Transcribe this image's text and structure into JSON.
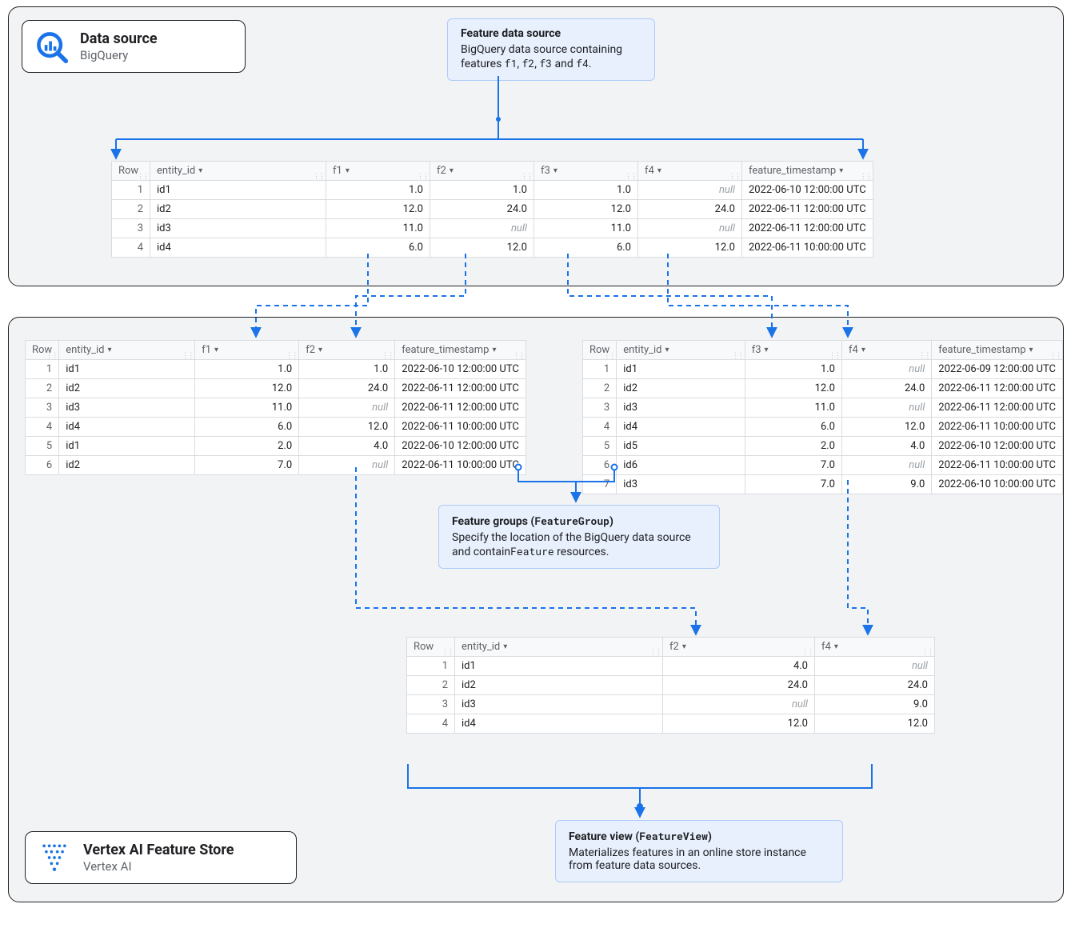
{
  "top": {
    "tag_title": "Data source",
    "tag_sub": "BigQuery",
    "callout": {
      "head": "Feature data source",
      "body_a": "BigQuery data source containing features ",
      "f1": "f1",
      "f2": "f2",
      "f3": "f3",
      "f4": "f4",
      "body_b": ", ",
      "body_c": " and ",
      "body_d": "."
    },
    "source_table": {
      "headers": [
        "Row",
        "entity_id",
        "f1",
        "f2",
        "f3",
        "f4",
        "feature_timestamp"
      ],
      "rows": [
        {
          "n": "1",
          "id": "id1",
          "f1": "1.0",
          "f2": "1.0",
          "f3": "1.0",
          "f4": "null",
          "ts": "2022-06-10 12:00:00 UTC"
        },
        {
          "n": "2",
          "id": "id2",
          "f1": "12.0",
          "f2": "24.0",
          "f3": "12.0",
          "f4": "24.0",
          "ts": "2022-06-11 12:00:00 UTC"
        },
        {
          "n": "3",
          "id": "id3",
          "f1": "11.0",
          "f2": "null",
          "f3": "11.0",
          "f4": "null",
          "ts": "2022-06-11 12:00:00 UTC"
        },
        {
          "n": "4",
          "id": "id4",
          "f1": "6.0",
          "f2": "12.0",
          "f3": "6.0",
          "f4": "12.0",
          "ts": "2022-06-11 10:00:00 UTC"
        }
      ]
    }
  },
  "bottom": {
    "tag_title": "Vertex AI Feature Store",
    "tag_sub": "Vertex AI",
    "group_callout": {
      "head_a": "Feature groups (",
      "head_b": "FeatureGroup",
      "head_c": ")",
      "line_a": "Specify the location of the BigQuery data source and contain",
      "line_b": "Feature",
      "line_c": " resources."
    },
    "view_callout": {
      "head_a": "Feature view (",
      "head_b": "FeatureView",
      "head_c": ")",
      "line": "Materializes features in an online store instance from feature data sources."
    },
    "left_table": {
      "headers": [
        "Row",
        "entity_id",
        "f1",
        "f2",
        "feature_timestamp"
      ],
      "rows": [
        {
          "n": "1",
          "id": "id1",
          "v1": "1.0",
          "v2": "1.0",
          "ts": "2022-06-10 12:00:00 UTC"
        },
        {
          "n": "2",
          "id": "id2",
          "v1": "12.0",
          "v2": "24.0",
          "ts": "2022-06-11 12:00:00 UTC"
        },
        {
          "n": "3",
          "id": "id3",
          "v1": "11.0",
          "v2": "null",
          "ts": "2022-06-11 12:00:00 UTC"
        },
        {
          "n": "4",
          "id": "id4",
          "v1": "6.0",
          "v2": "12.0",
          "ts": "2022-06-11 10:00:00 UTC"
        },
        {
          "n": "5",
          "id": "id1",
          "v1": "2.0",
          "v2": "4.0",
          "ts": "2022-06-10 12:00:00 UTC"
        },
        {
          "n": "6",
          "id": "id2",
          "v1": "7.0",
          "v2": "null",
          "ts": "2022-06-11 10:00:00 UTC"
        }
      ]
    },
    "right_table": {
      "headers": [
        "Row",
        "entity_id",
        "f3",
        "f4",
        "feature_timestamp"
      ],
      "rows": [
        {
          "n": "1",
          "id": "id1",
          "v1": "1.0",
          "v2": "null",
          "ts": "2022-06-09 12:00:00 UTC"
        },
        {
          "n": "2",
          "id": "id2",
          "v1": "12.0",
          "v2": "24.0",
          "ts": "2022-06-11 12:00:00 UTC"
        },
        {
          "n": "3",
          "id": "id3",
          "v1": "11.0",
          "v2": "null",
          "ts": "2022-06-11 12:00:00 UTC"
        },
        {
          "n": "4",
          "id": "id4",
          "v1": "6.0",
          "v2": "12.0",
          "ts": "2022-06-11 10:00:00 UTC"
        },
        {
          "n": "5",
          "id": "id5",
          "v1": "2.0",
          "v2": "4.0",
          "ts": "2022-06-10 12:00:00 UTC"
        },
        {
          "n": "6",
          "id": "id6",
          "v1": "7.0",
          "v2": "null",
          "ts": "2022-06-11 10:00:00 UTC"
        },
        {
          "n": "7",
          "id": "id3",
          "v1": "7.0",
          "v2": "9.0",
          "ts": "2022-06-10 10:00:00 UTC"
        }
      ]
    },
    "view_table": {
      "headers": [
        "Row",
        "entity_id",
        "f2",
        "f4"
      ],
      "rows": [
        {
          "n": "1",
          "id": "id1",
          "v1": "4.0",
          "v2": "null"
        },
        {
          "n": "2",
          "id": "id2",
          "v1": "24.0",
          "v2": "24.0"
        },
        {
          "n": "3",
          "id": "id3",
          "v1": "null",
          "v2": "9.0"
        },
        {
          "n": "4",
          "id": "id4",
          "v1": "12.0",
          "v2": "12.0"
        }
      ]
    }
  }
}
